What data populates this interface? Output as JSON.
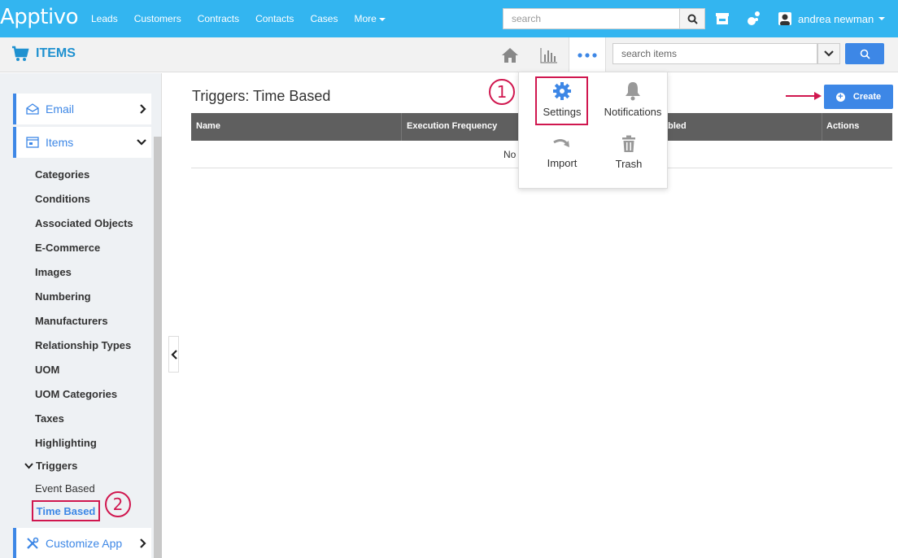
{
  "topbar": {
    "logo": "Apptivo",
    "nav": [
      "Leads",
      "Customers",
      "Contracts",
      "Contacts",
      "Cases",
      "More"
    ],
    "search_placeholder": "search",
    "user_name": "andrea newman",
    "bg_color": "#33b5f0"
  },
  "subbar": {
    "app_title": "ITEMS",
    "search_placeholder": "search items",
    "accent_color": "#3d87e6"
  },
  "dropdown": {
    "settings": "Settings",
    "notifications": "Notifications",
    "import": "Import",
    "trash": "Trash"
  },
  "sidebar": {
    "email": "Email",
    "items": "Items",
    "sub_items": [
      "Categories",
      "Conditions",
      "Associated Objects",
      "E-Commerce",
      "Images",
      "Numbering",
      "Manufacturers",
      "Relationship Types",
      "UOM",
      "UOM Categories",
      "Taxes",
      "Highlighting"
    ],
    "triggers": "Triggers",
    "event_based": "Event Based",
    "time_based": "Time Based",
    "customize_app": "Customize App"
  },
  "annotations": {
    "step1": "1",
    "step2": "2",
    "color": "#d0174f"
  },
  "main": {
    "title": "Triggers: Time Based",
    "create_label": "Create",
    "columns": [
      "Name",
      "Execution Frequency",
      "abled",
      "Actions"
    ],
    "empty_text": "No"
  }
}
